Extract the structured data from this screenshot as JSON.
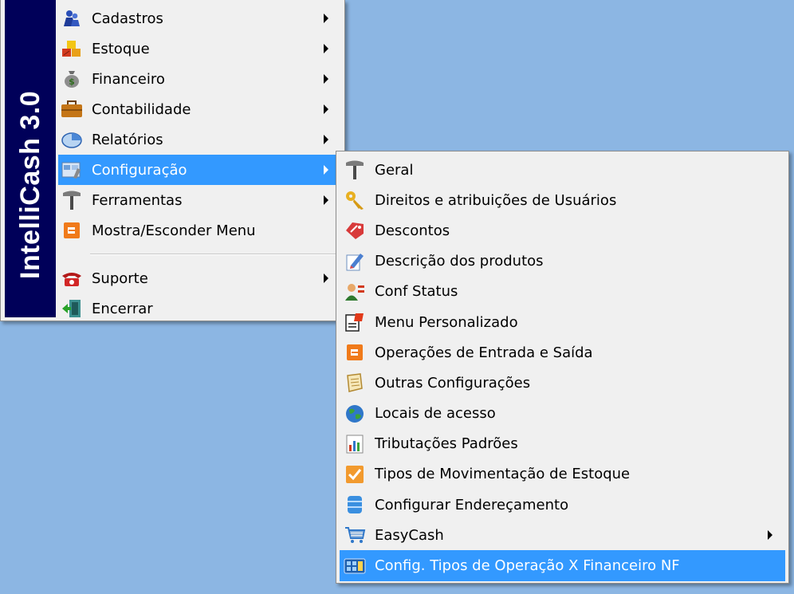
{
  "brand": "IntelliCash 3.0",
  "colors": {
    "desktop": "#8cb6e3",
    "menu_bg": "#f0f0f0",
    "brand_bar": "#000059",
    "highlight": "#3399ff"
  },
  "main_menu": {
    "items": [
      {
        "label": "Cadastros",
        "icon": "people-icon",
        "submenu": true
      },
      {
        "label": "Estoque",
        "icon": "boxes-icon",
        "submenu": true
      },
      {
        "label": "Financeiro",
        "icon": "money-bag-icon",
        "submenu": true
      },
      {
        "label": "Contabilidade",
        "icon": "briefcase-icon",
        "submenu": true
      },
      {
        "label": "Relatórios",
        "icon": "pie-chart-icon",
        "submenu": true
      },
      {
        "label": "Configuração",
        "icon": "config-icon",
        "submenu": true,
        "highlighted": true
      },
      {
        "label": "Ferramentas",
        "icon": "hammer-icon",
        "submenu": true
      },
      {
        "label": "Mostra/Esconder Menu",
        "icon": "toggle-menu-icon",
        "submenu": false
      },
      {
        "label": "Suporte",
        "icon": "telephone-icon",
        "submenu": true
      },
      {
        "label": "Encerrar",
        "icon": "exit-door-icon",
        "submenu": false
      }
    ]
  },
  "sub_menu": {
    "items": [
      {
        "label": "Geral",
        "icon": "hammer-icon"
      },
      {
        "label": "Direitos e atribuições de Usuários",
        "icon": "key-icon"
      },
      {
        "label": "Descontos",
        "icon": "price-tag-icon"
      },
      {
        "label": "Descrição dos produtos",
        "icon": "edit-document-icon"
      },
      {
        "label": "Conf Status",
        "icon": "user-status-icon"
      },
      {
        "label": "Menu Personalizado",
        "icon": "custom-menu-icon"
      },
      {
        "label": "Operações de Entrada e Saída",
        "icon": "operations-icon"
      },
      {
        "label": "Outras Configurações",
        "icon": "scroll-icon"
      },
      {
        "label": "Locais de acesso",
        "icon": "globe-icon"
      },
      {
        "label": "Tributações Padrões",
        "icon": "tax-chart-icon"
      },
      {
        "label": "Tipos de Movimentação de Estoque",
        "icon": "checkbox-icon"
      },
      {
        "label": "Configurar Endereçamento",
        "icon": "database-icon"
      },
      {
        "label": "EasyCash",
        "icon": "cart-icon",
        "submenu": true
      },
      {
        "label": "Config. Tipos de Operação X Financeiro NF",
        "icon": "calculator-icon",
        "highlighted": true
      }
    ]
  }
}
